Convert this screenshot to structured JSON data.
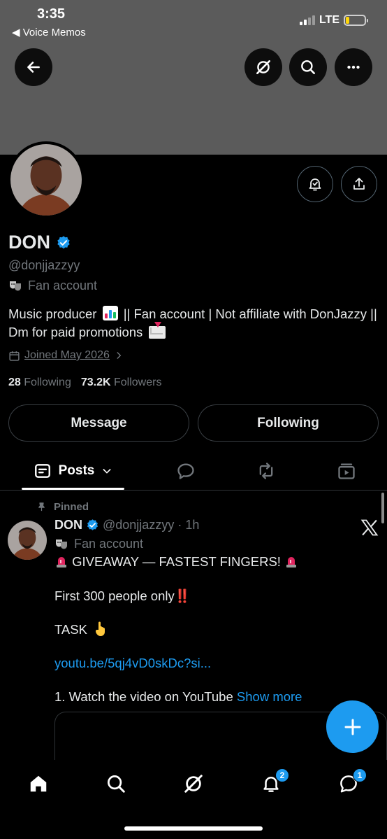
{
  "status_bar": {
    "time": "3:35",
    "back_app": "◀ Voice Memos",
    "network": "LTE",
    "battery_level": 0.2
  },
  "header_actions": {
    "back_icon": "arrow-left-icon",
    "grok_icon": "grok-icon",
    "search_icon": "search-icon",
    "more_icon": "more-icon"
  },
  "profile": {
    "name": "DON",
    "handle": "@donjjazzyy",
    "fan_label": "Fan account",
    "bio_part1": "Music producer",
    "bio_part2": "|| Fan account | Not affiliate with DonJazzy || Dm for paid promotions",
    "joined": "Joined May 2026",
    "following_count": "28",
    "following_label": "Following",
    "followers_count": "73.2K",
    "followers_label": "Followers"
  },
  "actions": {
    "message": "Message",
    "following": "Following"
  },
  "tabs": {
    "posts": "Posts"
  },
  "post": {
    "pinned_label": "Pinned",
    "author": "DON",
    "handle": "@donjjazzyy",
    "time": "· 1h",
    "fan_label": "Fan account",
    "line1": "GIVEAWAY — FASTEST FINGERS!",
    "line2": "First 300 people only",
    "line2_mark": "‼️",
    "line3": "TASK",
    "link": "youtu.be/5qj4vD0skDc?si...",
    "line4": "1. Watch the video on YouTube",
    "show_more": "Show more"
  },
  "bottom_nav": {
    "notifications_badge": "2",
    "messages_badge": "1"
  },
  "colors": {
    "accent": "#1d9bf0",
    "muted": "#71767b",
    "banner": "#5b5b5b"
  }
}
